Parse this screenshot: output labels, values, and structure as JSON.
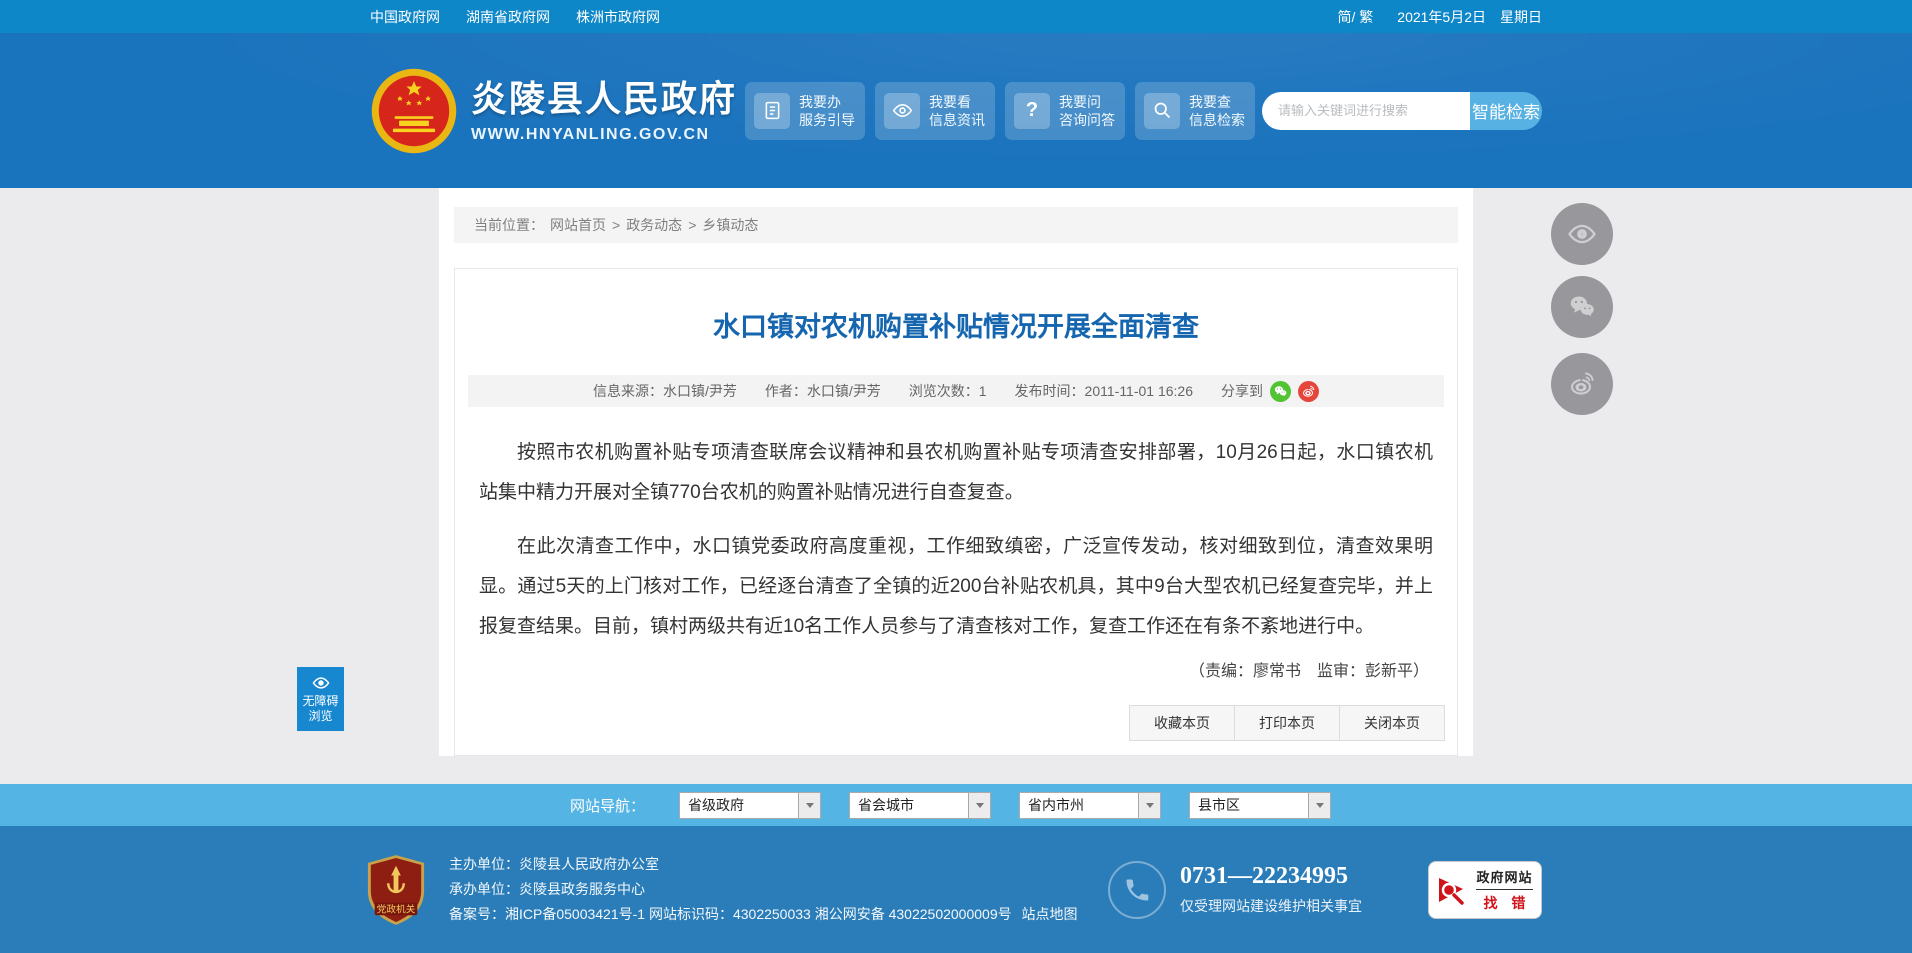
{
  "topbar": {
    "links": [
      "中国政府网",
      "湖南省政府网",
      "株洲市政府网"
    ],
    "lang_toggle": "简/ 繁",
    "date": "2021年5月2日　星期日"
  },
  "header": {
    "site_name": "炎陵县人民政府",
    "site_url": "WWW.HNYANLING.GOV.CN",
    "quick_buttons": [
      {
        "line1": "我要办",
        "line2": "服务引导"
      },
      {
        "line1": "我要看",
        "line2": "信息资讯"
      },
      {
        "line1": "我要问",
        "line2": "咨询问答"
      },
      {
        "line1": "我要查",
        "line2": "信息检索"
      }
    ],
    "question_glyph": "?",
    "search": {
      "placeholder": "请输入关键词进行搜索",
      "button": "智能检索"
    }
  },
  "breadcrumb": {
    "label": "当前位置：",
    "separator": ">",
    "items": [
      "网站首页",
      "政务动态",
      "乡镇动态"
    ]
  },
  "article": {
    "title": "水口镇对农机购置补贴情况开展全面清查",
    "meta": {
      "source_label": "信息来源：",
      "source": "水口镇/尹芳",
      "author_label": "作者：",
      "author": "水口镇/尹芳",
      "views_label": "浏览次数：",
      "views": "1",
      "time_label": "发布时间：",
      "time": "2011-11-01 16:26",
      "share_label": "分享到"
    },
    "paragraphs": [
      "按照市农机购置补贴专项清查联席会议精神和县农机购置补贴专项清查安排部署，10月26日起，水口镇农机站集中精力开展对全镇770台农机的购置补贴情况进行自查复查。",
      "在此次清查工作中，水口镇党委政府高度重视，工作细致缜密，广泛宣传发动，核对细致到位，清查效果明显。通过5天的上门核对工作，已经逐台清查了全镇的近200台补贴农机具，其中9台大型农机已经复查完毕，并上报复查结果。目前，镇村两级共有近10名工作人员参与了清查核对工作，复查工作还在有条不紊地进行中。"
    ],
    "byline": "（责编：廖常书　监审：彭新平）",
    "actions": [
      "收藏本页",
      "打印本页",
      "关闭本页"
    ]
  },
  "sitenav": {
    "label": "网站导航：",
    "selects": [
      "省级政府",
      "省会城市",
      "省内市州",
      "县市区"
    ]
  },
  "footer": {
    "badge_text": "党政机关",
    "organizer_label": "主办单位：",
    "organizer": "炎陵县人民政府办公室",
    "undertaker_label": "承办单位：",
    "undertaker": "炎陵县政务服务中心",
    "record_line": "备案号：湘ICP备05003421号-1 网站标识码：4302250033 湘公网安备 43022502000009号",
    "sitemap_label": "站点地图",
    "phone": "0731—22234995",
    "phone_note": "仅受理网站建设维护相关事宜",
    "error_badge": {
      "line1": "政府网站",
      "line2": "找 错"
    }
  },
  "floaters": {
    "accessibility_line1": "无障碍",
    "accessibility_line2": "浏览"
  },
  "colors": {
    "topbar": "#0e87c9",
    "header": "#1a73bd",
    "navbar": "#54b4e4",
    "footer": "#2b7db9",
    "title_blue": "#1566af",
    "wechat_green": "#52c332",
    "weibo_red": "#e6453c",
    "accessibility_blue": "#1787d0"
  }
}
